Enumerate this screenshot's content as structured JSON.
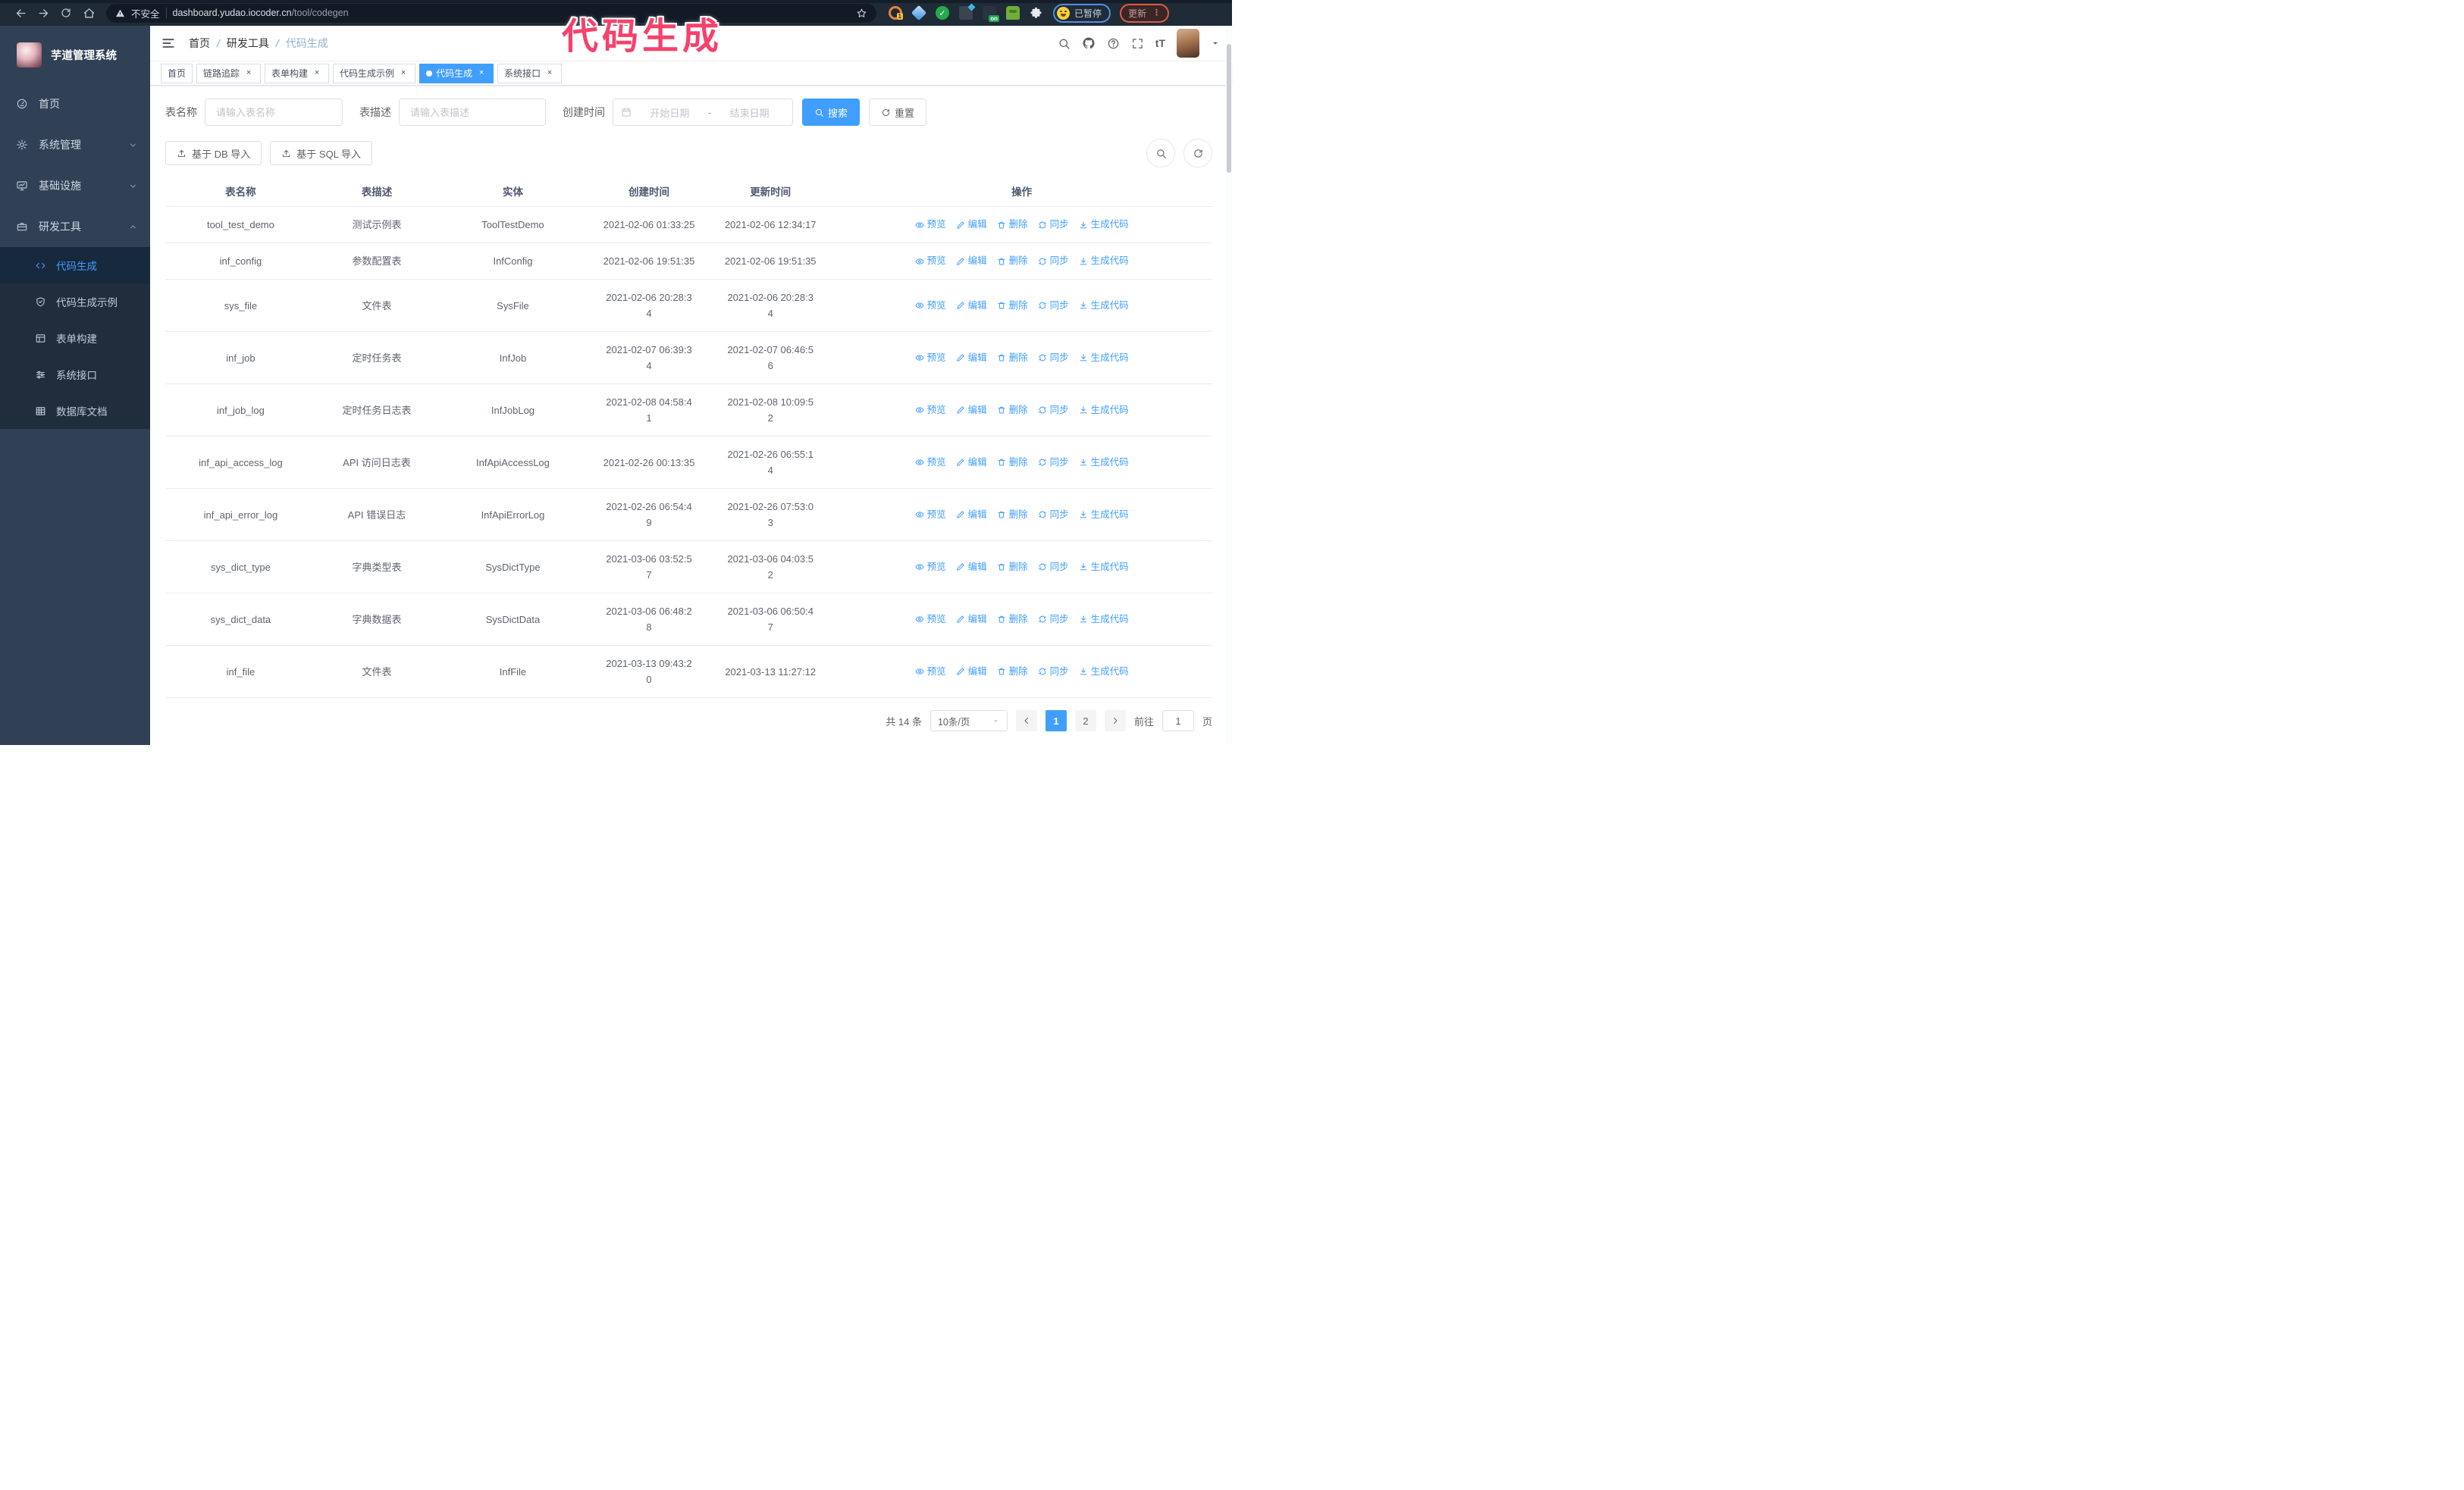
{
  "browser": {
    "security_warning": "不安全",
    "url_domain": "dashboard.yudao.iocoder.cn",
    "url_path": "/tool/codegen",
    "extension_badge": "1",
    "extension_on_badge": "on",
    "profile_status": "已暂停",
    "update_label": "更新"
  },
  "overlay": {
    "text": "代码生成",
    "color": "#f4426c"
  },
  "sidebar": {
    "title": "芋道管理系统",
    "items": [
      {
        "label": "首页",
        "icon": "dashboard",
        "chevron": "none"
      },
      {
        "label": "系统管理",
        "icon": "gear",
        "chevron": "down"
      },
      {
        "label": "基础设施",
        "icon": "monitor",
        "chevron": "down"
      },
      {
        "label": "研发工具",
        "icon": "briefcase",
        "chevron": "up"
      }
    ],
    "submenu": [
      {
        "label": "代码生成",
        "icon": "code",
        "active": true
      },
      {
        "label": "代码生成示例",
        "icon": "shield",
        "active": false
      },
      {
        "label": "表单构建",
        "icon": "form",
        "active": false
      },
      {
        "label": "系统接口",
        "icon": "sliders",
        "active": false
      },
      {
        "label": "数据库文档",
        "icon": "grid",
        "active": false
      }
    ]
  },
  "breadcrumb": [
    "首页",
    "研发工具",
    "代码生成"
  ],
  "tabs": [
    {
      "label": "首页",
      "closable": false,
      "active": false
    },
    {
      "label": "链路追踪",
      "closable": true,
      "active": false
    },
    {
      "label": "表单构建",
      "closable": true,
      "active": false
    },
    {
      "label": "代码生成示例",
      "closable": true,
      "active": false
    },
    {
      "label": "代码生成",
      "closable": true,
      "active": true
    },
    {
      "label": "系统接口",
      "closable": true,
      "active": false
    }
  ],
  "filters": {
    "name_label": "表名称",
    "name_placeholder": "请输入表名称",
    "desc_label": "表描述",
    "desc_placeholder": "请输入表描述",
    "time_label": "创建时间",
    "start_placeholder": "开始日期",
    "range_separator": "-",
    "end_placeholder": "结束日期",
    "search_label": "搜索",
    "reset_label": "重置"
  },
  "toolbar": {
    "import_db_label": "基于 DB 导入",
    "import_sql_label": "基于 SQL 导入"
  },
  "table": {
    "headers": [
      "表名称",
      "表描述",
      "实体",
      "创建时间",
      "更新时间",
      "操作"
    ],
    "action_labels": [
      "预览",
      "编辑",
      "删除",
      "同步",
      "生成代码"
    ],
    "rows": [
      {
        "name": "tool_test_demo",
        "desc": "测试示例表",
        "entity": "ToolTestDemo",
        "created": "2021-02-06 01:33:25",
        "updated": "2021-02-06 12:34:17"
      },
      {
        "name": "inf_config",
        "desc": "参数配置表",
        "entity": "InfConfig",
        "created": "2021-02-06 19:51:35",
        "updated": "2021-02-06 19:51:35"
      },
      {
        "name": "sys_file",
        "desc": "文件表",
        "entity": "SysFile",
        "created": "2021-02-06 20:28:3\n4",
        "updated": "2021-02-06 20:28:3\n4"
      },
      {
        "name": "inf_job",
        "desc": "定时任务表",
        "entity": "InfJob",
        "created": "2021-02-07 06:39:3\n4",
        "updated": "2021-02-07 06:46:5\n6"
      },
      {
        "name": "inf_job_log",
        "desc": "定时任务日志表",
        "entity": "InfJobLog",
        "created": "2021-02-08 04:58:4\n1",
        "updated": "2021-02-08 10:09:5\n2"
      },
      {
        "name": "inf_api_access_log",
        "desc": "API 访问日志表",
        "entity": "InfApiAccessLog",
        "created": "2021-02-26 00:13:35",
        "updated": "2021-02-26 06:55:1\n4"
      },
      {
        "name": "inf_api_error_log",
        "desc": "API 错误日志",
        "entity": "InfApiErrorLog",
        "created": "2021-02-26 06:54:4\n9",
        "updated": "2021-02-26 07:53:0\n3"
      },
      {
        "name": "sys_dict_type",
        "desc": "字典类型表",
        "entity": "SysDictType",
        "created": "2021-03-06 03:52:5\n7",
        "updated": "2021-03-06 04:03:5\n2"
      },
      {
        "name": "sys_dict_data",
        "desc": "字典数据表",
        "entity": "SysDictData",
        "created": "2021-03-06 06:48:2\n8",
        "updated": "2021-03-06 06:50:4\n7"
      },
      {
        "name": "inf_file",
        "desc": "文件表",
        "entity": "InfFile",
        "created": "2021-03-13 09:43:2\n0",
        "updated": "2021-03-13 11:27:12"
      }
    ]
  },
  "pagination": {
    "total_text": "共 14 条",
    "page_size_text": "10条/页",
    "pages": [
      "1",
      "2"
    ],
    "active_page": "1",
    "goto_label": "前往",
    "goto_value": "1",
    "goto_suffix": "页"
  },
  "colors": {
    "accent": "#409EFF",
    "sidebar_bg": "#304156",
    "submenu_bg": "#1f2d3d",
    "chrome_bg": "#1f2b37",
    "annotation_pink": "#f4426c"
  }
}
